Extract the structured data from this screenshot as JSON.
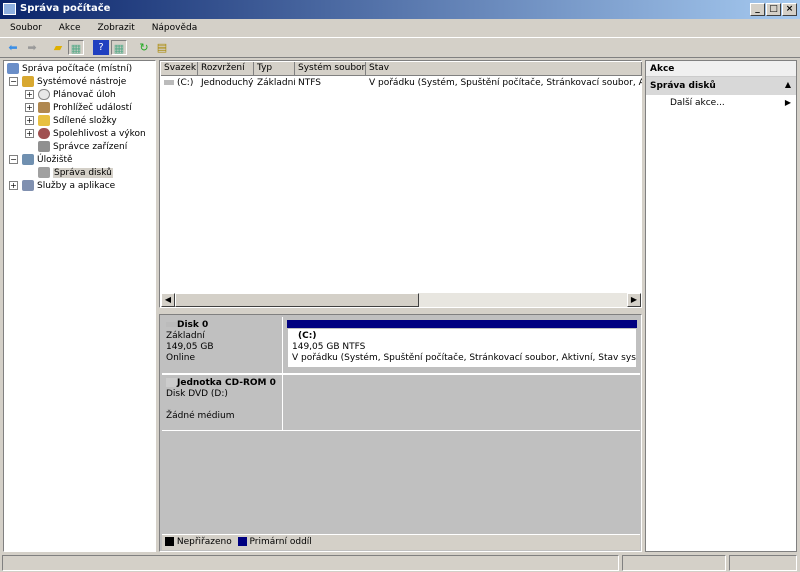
{
  "window": {
    "title": "Správa počítače"
  },
  "menu": [
    "Soubor",
    "Akce",
    "Zobrazit",
    "Nápověda"
  ],
  "tree": {
    "root": "Správa počítače (místní)",
    "items": [
      {
        "label": "Systémové nástroje",
        "level": 1,
        "expander": "−"
      },
      {
        "label": "Plánovač úloh",
        "level": 2,
        "expander": "+"
      },
      {
        "label": "Prohlížeč událostí",
        "level": 2,
        "expander": "+"
      },
      {
        "label": "Sdílené složky",
        "level": 2,
        "expander": "+"
      },
      {
        "label": "Spolehlivost a výkon",
        "level": 2,
        "expander": "+"
      },
      {
        "label": "Správce zařízení",
        "level": 2,
        "expander": ""
      },
      {
        "label": "Úložiště",
        "level": 1,
        "expander": "−"
      },
      {
        "label": "Správa disků",
        "level": 2,
        "expander": "",
        "selected": true
      },
      {
        "label": "Služby a aplikace",
        "level": 1,
        "expander": "+"
      }
    ]
  },
  "volume_list": {
    "columns": [
      "Svazek",
      "Rozvržení",
      "Typ",
      "Systém souborů",
      "Stav"
    ],
    "rows": [
      {
        "volume": "(C:)",
        "layout": "Jednoduchý",
        "type": "Základní",
        "fs": "NTFS",
        "status": "V pořádku (Systém, Spuštění počítače, Stránkovací soubor, Aktivní, Stav systému, Primární oddíl)"
      }
    ]
  },
  "disks": [
    {
      "name": "Disk 0",
      "type": "Základní",
      "size": "149,05 GB",
      "state": "Online",
      "partition": {
        "label": "(C:)",
        "size_fs": "149,05 GB NTFS",
        "status": "V pořádku (Systém, Spuštění počítače, Stránkovací soubor, Aktivní, Stav systému, Primární oddíl)"
      }
    },
    {
      "name": "Jednotka CD-ROM 0",
      "type": "Disk DVD (D:)",
      "media": "Žádné médium"
    }
  ],
  "legend": [
    {
      "label": "Nepřiřazeno",
      "color": "#000000"
    },
    {
      "label": "Primární oddíl",
      "color": "#000080"
    }
  ],
  "actions": {
    "header": "Akce",
    "section": "Správa disků",
    "items": [
      "Další akce..."
    ]
  }
}
